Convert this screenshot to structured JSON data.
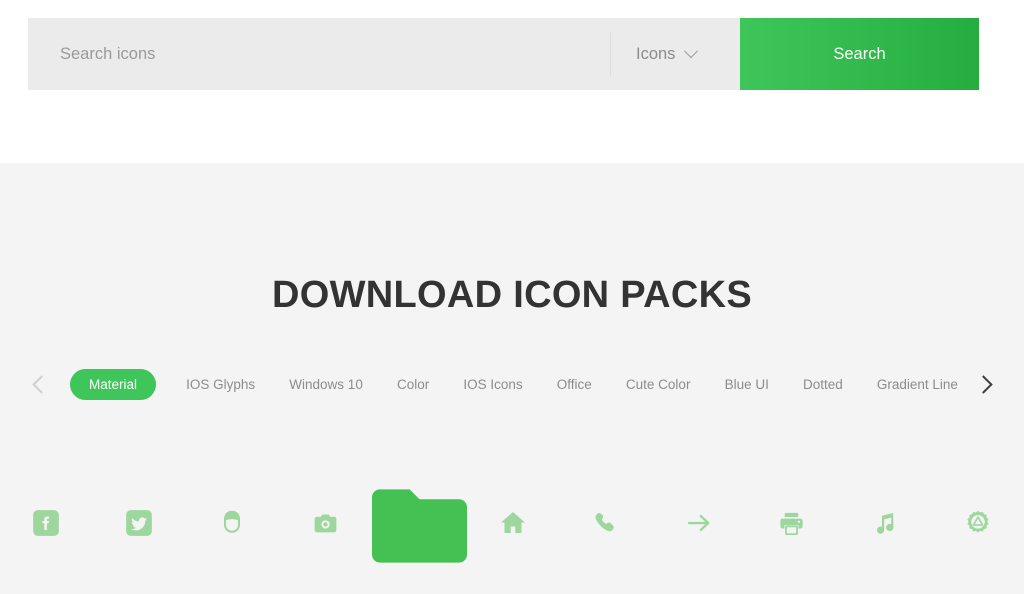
{
  "search": {
    "placeholder": "Search icons",
    "value": "",
    "category_label": "Icons",
    "category_icon": "chevron-down-icon",
    "button_label": "Search",
    "button_gradient_from": "#3ec65a",
    "button_gradient_to": "#25ad3f"
  },
  "main": {
    "title": "DOWNLOAD ICON PACKS",
    "background": "#f4f4f4"
  },
  "tabs": {
    "prev_icon": "chevron-left-icon",
    "next_icon": "chevron-right-icon",
    "active_color": "#3ec65a",
    "items": [
      {
        "label": "Material",
        "active": true
      },
      {
        "label": "IOS Glyphs",
        "active": false
      },
      {
        "label": "Windows 10",
        "active": false
      },
      {
        "label": "Color",
        "active": false
      },
      {
        "label": "IOS Icons",
        "active": false
      },
      {
        "label": "Office",
        "active": false
      },
      {
        "label": "Cute Color",
        "active": false
      },
      {
        "label": "Blue UI",
        "active": false
      },
      {
        "label": "Dotted",
        "active": false
      },
      {
        "label": "Gradient Line",
        "active": false
      }
    ]
  },
  "icon_showcase": {
    "muted_color": "#9ed79e",
    "featured_color": "#45c council",
    "featured_color_hex": "#45c153",
    "items": [
      {
        "name": "facebook-icon",
        "featured": false
      },
      {
        "name": "twitter-icon",
        "featured": false
      },
      {
        "name": "user-avatar-icon",
        "featured": false
      },
      {
        "name": "camera-icon",
        "featured": false
      },
      {
        "name": "folder-icon",
        "featured": true
      },
      {
        "name": "home-icon",
        "featured": false
      },
      {
        "name": "phone-icon",
        "featured": false
      },
      {
        "name": "arrow-right-icon",
        "featured": false
      },
      {
        "name": "printer-icon",
        "featured": false
      },
      {
        "name": "music-note-icon",
        "featured": false
      },
      {
        "name": "settings-gear-icon",
        "featured": false
      }
    ]
  }
}
